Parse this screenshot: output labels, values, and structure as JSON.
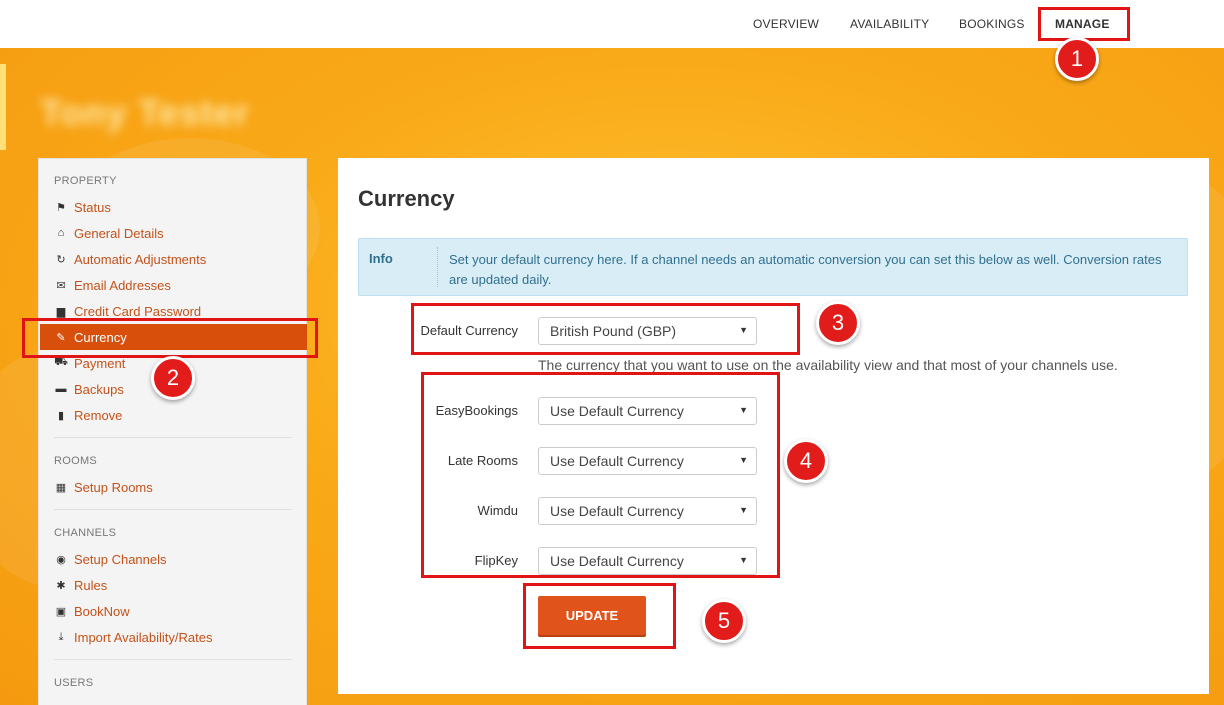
{
  "nav": {
    "items": [
      {
        "label": "OVERVIEW"
      },
      {
        "label": "AVAILABILITY"
      },
      {
        "label": "BOOKINGS"
      },
      {
        "label": "MANAGE"
      }
    ]
  },
  "hotel_name": "Tony Tester",
  "sidebar": {
    "sections": [
      {
        "heading": "PROPERTY",
        "items": [
          {
            "label": "Status",
            "icon": "flag-icon"
          },
          {
            "label": "General Details",
            "icon": "home-icon"
          },
          {
            "label": "Automatic Adjustments",
            "icon": "refresh-icon"
          },
          {
            "label": "Email Addresses",
            "icon": "envelope-icon"
          },
          {
            "label": "Credit Card Password",
            "icon": "lock-icon"
          },
          {
            "label": "Currency",
            "icon": "edit-icon"
          },
          {
            "label": "Payment",
            "icon": "cart-icon"
          },
          {
            "label": "Backups",
            "icon": "hdd-icon"
          },
          {
            "label": "Remove",
            "icon": "trash-icon"
          }
        ]
      },
      {
        "heading": "ROOMS",
        "items": [
          {
            "label": "Setup Rooms",
            "icon": "grid-icon"
          }
        ]
      },
      {
        "heading": "CHANNELS",
        "items": [
          {
            "label": "Setup Channels",
            "icon": "globe-icon"
          },
          {
            "label": "Rules",
            "icon": "asterisk-icon"
          },
          {
            "label": "BookNow",
            "icon": "gift-icon"
          },
          {
            "label": "Import Availability/Rates",
            "icon": "import-icon"
          }
        ]
      },
      {
        "heading": "USERS",
        "items": []
      }
    ]
  },
  "main": {
    "title": "Currency",
    "info": {
      "label": "Info",
      "text": "Set your default currency here. If a channel needs an automatic conversion you can set this below as well. Conversion rates are updated daily."
    },
    "default_currency": {
      "label": "Default Currency",
      "value": "British Pound (GBP)",
      "help": "The currency that you want to use on the availability view and that most of your channels use."
    },
    "channels": [
      {
        "label": "EasyBookings",
        "value": "Use Default Currency"
      },
      {
        "label": "Late Rooms",
        "value": "Use Default Currency"
      },
      {
        "label": "Wimdu",
        "value": "Use Default Currency"
      },
      {
        "label": "FlipKey",
        "value": "Use Default Currency"
      }
    ],
    "update_label": "UPDATE"
  },
  "annotations": [
    "1",
    "2",
    "3",
    "4",
    "5"
  ],
  "colors": {
    "accent": "#d84f0c",
    "link": "#c4521a",
    "annotation": "#e01414",
    "background": "#f7a51c"
  }
}
